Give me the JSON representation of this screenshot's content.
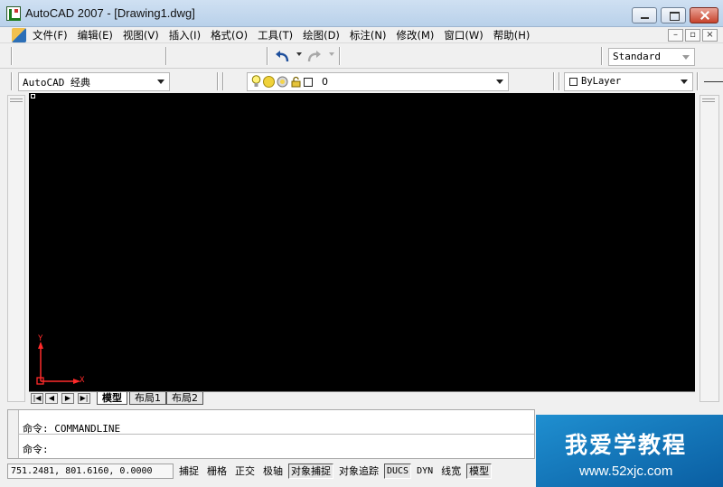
{
  "window": {
    "title": "AutoCAD 2007 - [Drawing1.dwg]"
  },
  "menu": {
    "items": [
      "文件(F)",
      "编辑(E)",
      "视图(V)",
      "插入(I)",
      "格式(O)",
      "工具(T)",
      "绘图(D)",
      "标注(N)",
      "修改(M)",
      "窗口(W)",
      "帮助(H)"
    ]
  },
  "toolbar": {
    "text_style": "Standard",
    "workspace": "AutoCAD 经典",
    "layer_name": "0",
    "color": "ByLayer"
  },
  "drawing": {
    "background": "#000000",
    "ucs_x_label": "X",
    "ucs_y_label": "Y",
    "ucs_color": "#ff2a2a"
  },
  "layout_tabs": {
    "nav": [
      "|◀",
      "◀",
      "▶",
      "▶|"
    ],
    "tabs": [
      "模型",
      "布局1",
      "布局2"
    ],
    "active": "模型"
  },
  "command_line": {
    "history": "命令: COMMANDLINE",
    "prompt": "命令:"
  },
  "status_bar": {
    "coordinates": "751.2481, 801.6160, 0.0000",
    "toggles": [
      "捕捉",
      "栅格",
      "正交",
      "极轴",
      "对象捕捉",
      "对象追踪",
      "DUCS",
      "DYN",
      "线宽",
      "模型"
    ],
    "pressed": [
      "对象捕捉",
      "DUCS",
      "模型"
    ]
  },
  "watermark": {
    "main": "我爱学教程",
    "url": "www.52xjc.com",
    "color": "#1477bb"
  }
}
